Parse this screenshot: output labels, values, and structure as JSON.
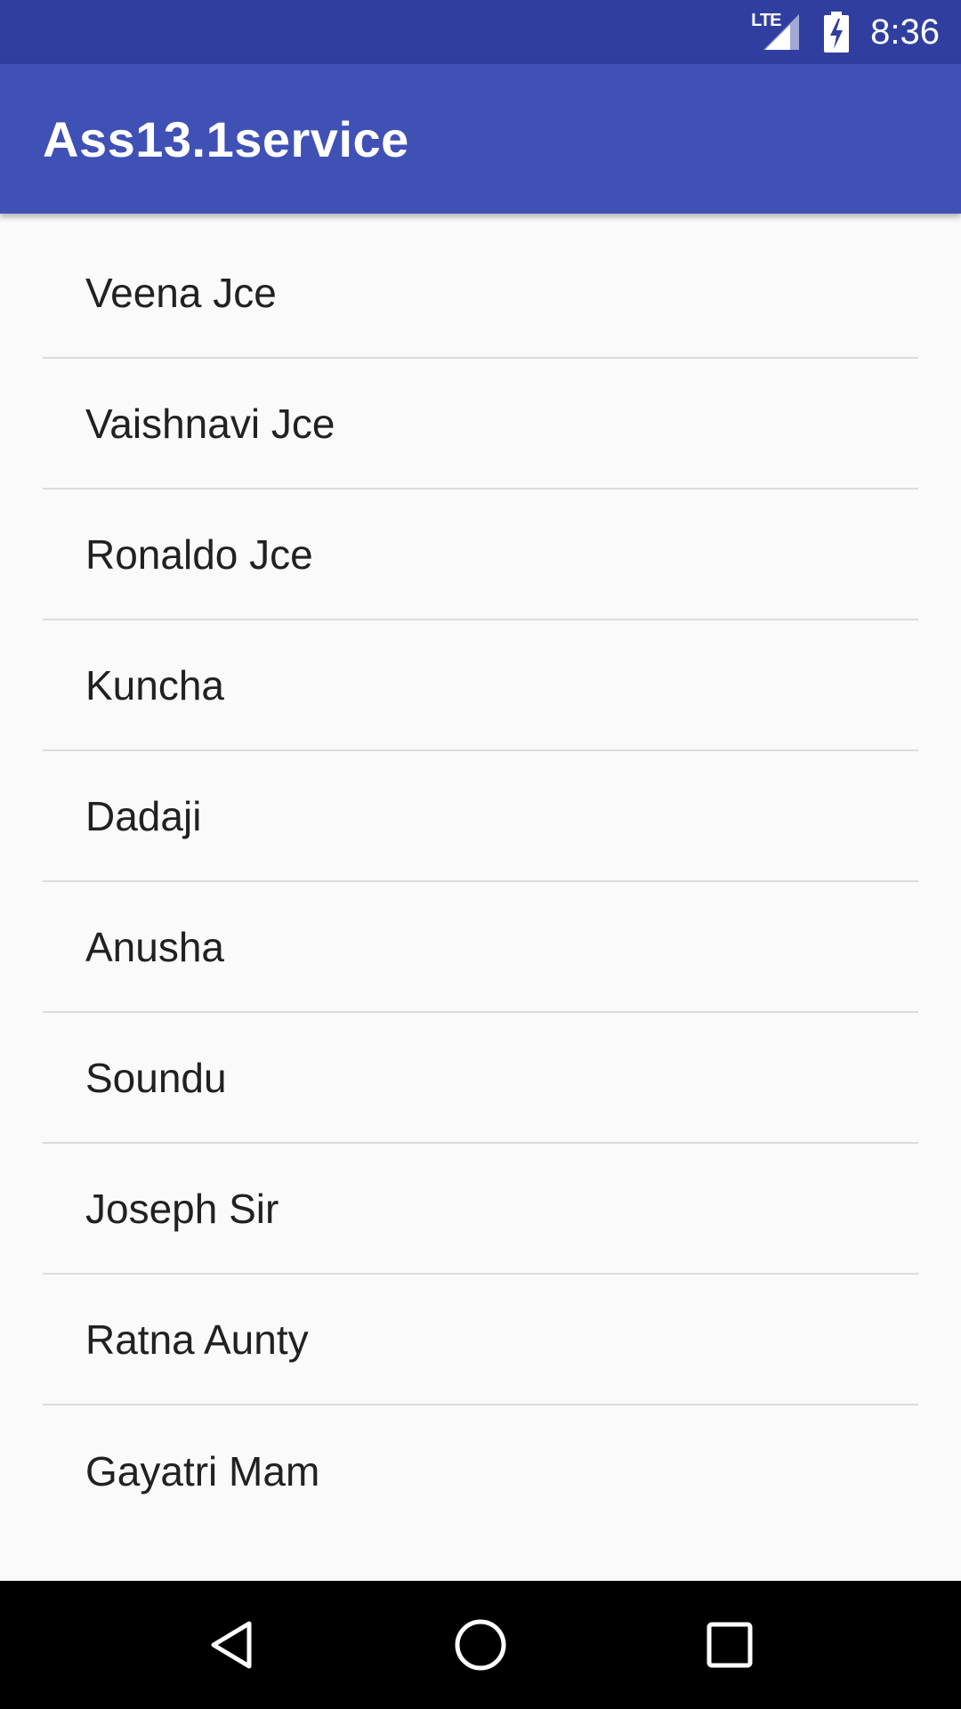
{
  "status_bar": {
    "network_label": "LTE",
    "time": "8:36",
    "icons": [
      "lte-signal-icon",
      "battery-charging-icon"
    ]
  },
  "app_bar": {
    "title": "Ass13.1service"
  },
  "contacts": [
    "Veena Jce",
    "Vaishnavi Jce",
    "Ronaldo Jce",
    "Kuncha",
    "Dadaji",
    "Anusha",
    "Soundu",
    "Joseph Sir",
    "Ratna Aunty",
    "Gayatri Mam"
  ],
  "nav_bar": {
    "buttons": [
      "back-icon",
      "home-icon",
      "recents-icon"
    ]
  },
  "colors": {
    "status_bar": "#303f9f",
    "app_bar": "#3f51b5",
    "background": "#fafafa",
    "divider": "#dcdcdc",
    "text": "#212121"
  }
}
